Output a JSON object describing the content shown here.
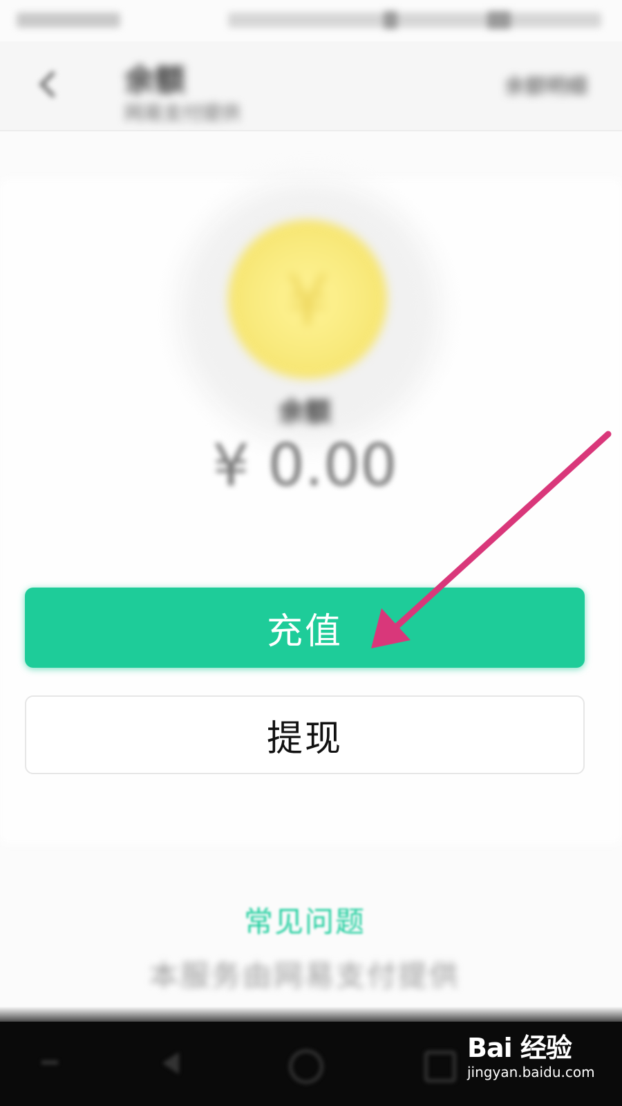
{
  "header": {
    "title": "余额",
    "subtitle": "网易支付提供",
    "right_action": "余额明细"
  },
  "balance": {
    "label": "余额",
    "amount": "¥ 0.00"
  },
  "actions": {
    "recharge_label": "充值",
    "withdraw_label": "提现"
  },
  "faq": {
    "link_label": "常见问题",
    "footer_note": "本服务由网易支付提供"
  },
  "annotation": {
    "color": "#d9377a"
  },
  "colors": {
    "accent": "#1ecc99",
    "faq_text": "#24cfa0",
    "coin": "#f8e97b"
  },
  "icons": {
    "back": "chevron-left-icon",
    "coin": "yuan-coin-icon",
    "nav_menu": "menu-icon",
    "nav_back": "triangle-back-icon",
    "nav_home": "circle-home-icon",
    "nav_recent": "square-recent-icon"
  },
  "watermark": {
    "logo": "Bai 经验",
    "url": "jingyan.baidu.com"
  }
}
